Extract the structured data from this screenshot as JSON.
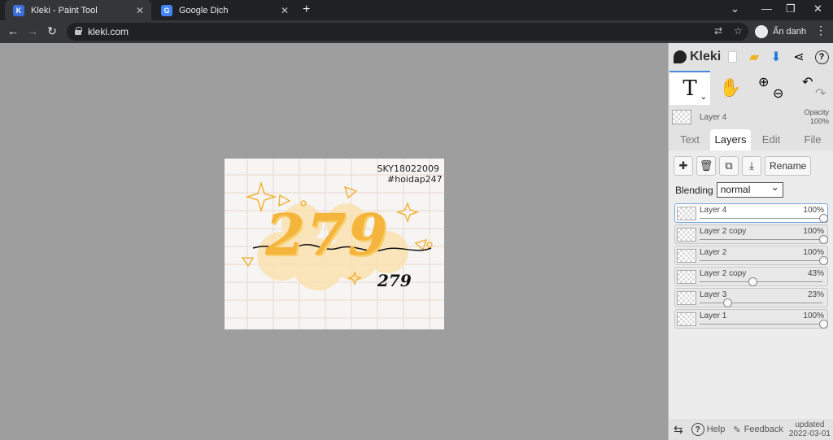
{
  "browser": {
    "tabs": [
      {
        "title": "Kleki - Paint Tool",
        "favicon_color": "#3b6fd8"
      },
      {
        "title": "Google Dịch",
        "favicon_color": "#4285f4"
      }
    ],
    "tab_close": "✕",
    "new_tab": "+",
    "window_controls": {
      "dropdown": "⌄",
      "minimize": "—",
      "restore": "❐",
      "close": "✕"
    },
    "url": "kleki.com",
    "incognito_label": "Ẩn danh"
  },
  "canvas": {
    "text_signature": "SKY18022009",
    "text_hashtag": "#hoidap247",
    "big_text": "279",
    "small_text": "279"
  },
  "panel": {
    "app_name": "Kleki",
    "current_layer_name": "Layer 4",
    "opacity_label": "Opacity",
    "opacity_value": "100%",
    "tabs": [
      "Text",
      "Layers",
      "Edit",
      "File"
    ],
    "rename_label": "Rename",
    "blending_label": "Blending",
    "blending_value": "normal",
    "layers": [
      {
        "name": "Layer 4",
        "opacity": "100%",
        "level": 1.0,
        "active": true
      },
      {
        "name": "Layer 2 copy",
        "opacity": "100%",
        "level": 1.0,
        "active": false
      },
      {
        "name": "Layer 2",
        "opacity": "100%",
        "level": 1.0,
        "active": false
      },
      {
        "name": "Layer 2 copy",
        "opacity": "43%",
        "level": 0.43,
        "active": false
      },
      {
        "name": "Layer 3",
        "opacity": "23%",
        "level": 0.23,
        "active": false
      },
      {
        "name": "Layer 1",
        "opacity": "100%",
        "level": 1.0,
        "active": false
      }
    ],
    "footer": {
      "help_label": "Help",
      "feedback_label": "Feedback",
      "updated_label": "updated",
      "updated_date": "2022-03-01"
    }
  },
  "colors": {
    "accent": "#4a89dc",
    "brand_yellow": "#f5b53c"
  }
}
